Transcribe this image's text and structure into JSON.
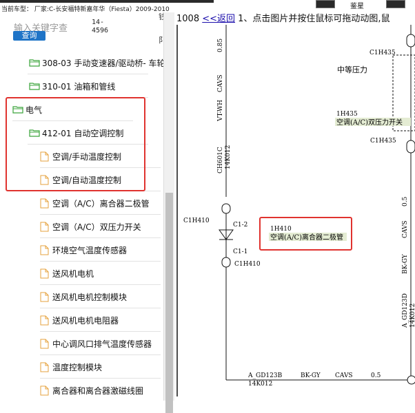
{
  "topbar": {
    "current_vehicle": "当前车型：  厂家:C-长安福特新嘉年华（Fiesta）2009-2010",
    "icon_label": "鉴星"
  },
  "search": {
    "placeholder": "输入关键字查",
    "button_label": "查询",
    "code_text": "14-\n4596",
    "side_char_1": "钱",
    "side_char_2": "阝"
  },
  "tree": {
    "items": [
      {
        "type": "folder",
        "label": "308-03 手动变速器/驱动桥- 车轮"
      },
      {
        "type": "folder",
        "label": "310-01 油箱和管线"
      },
      {
        "type": "folder-open",
        "label": "电气"
      },
      {
        "type": "folder",
        "label": "412-01 自动空调控制"
      },
      {
        "type": "doc",
        "label": "空调/手动温度控制"
      },
      {
        "type": "doc",
        "label": "空调/自动温度控制"
      },
      {
        "type": "doc",
        "label": "空调（A/C）离合器二极管"
      },
      {
        "type": "doc",
        "label": "空调（A/C）双压力开关"
      },
      {
        "type": "doc",
        "label": "环境空气温度传感器"
      },
      {
        "type": "doc",
        "label": "送风机电机"
      },
      {
        "type": "doc",
        "label": "送风机电机控制模块"
      },
      {
        "type": "doc",
        "label": "送风机电机电阻器"
      },
      {
        "type": "doc",
        "label": "中心调风口排气温度传感器"
      },
      {
        "type": "doc",
        "label": "温度控制模块"
      },
      {
        "type": "doc",
        "label": "离合器和离合器激磁线圈"
      }
    ]
  },
  "header": {
    "page_no": "1008",
    "back_link": "<<返回",
    "instruction": " 1、点击图片并按住鼠标可拖动动图,鼠"
  },
  "diagram": {
    "left_wire_top_label": "0.85",
    "left_wire_label_1": "CAVS",
    "left_wire_label_2": "VT-WH",
    "left_wire_label_3": "CH601C",
    "left_wire_label_4": "14K012",
    "conn_c1h435_top": "C1H435",
    "medium_pressure": "中等压力",
    "switch_code": "1H435",
    "switch_name": "空调(A/C)双压力开关",
    "conn_c1h435_bottom": "C1H435",
    "diode_conn_left": "C1H410",
    "diode_pin_2": "C1-2",
    "diode_pin_1": "C1-1",
    "diode_conn_bottom": "C1H410",
    "diode_code": "1H410",
    "diode_name": "空调(A/C)离合器二极管",
    "right_wire_1": "0.5",
    "right_wire_2": "CAVS",
    "right_wire_3": "BK-GY",
    "right_wire_4": "A_GD123D",
    "right_wire_5": "14K012",
    "bottom_1": "A_GD123B",
    "bottom_2": "14K012",
    "bottom_3": "BK-GY",
    "bottom_4": "CAVS",
    "bottom_5": "0.5",
    "accent_red": "#e0322e"
  }
}
